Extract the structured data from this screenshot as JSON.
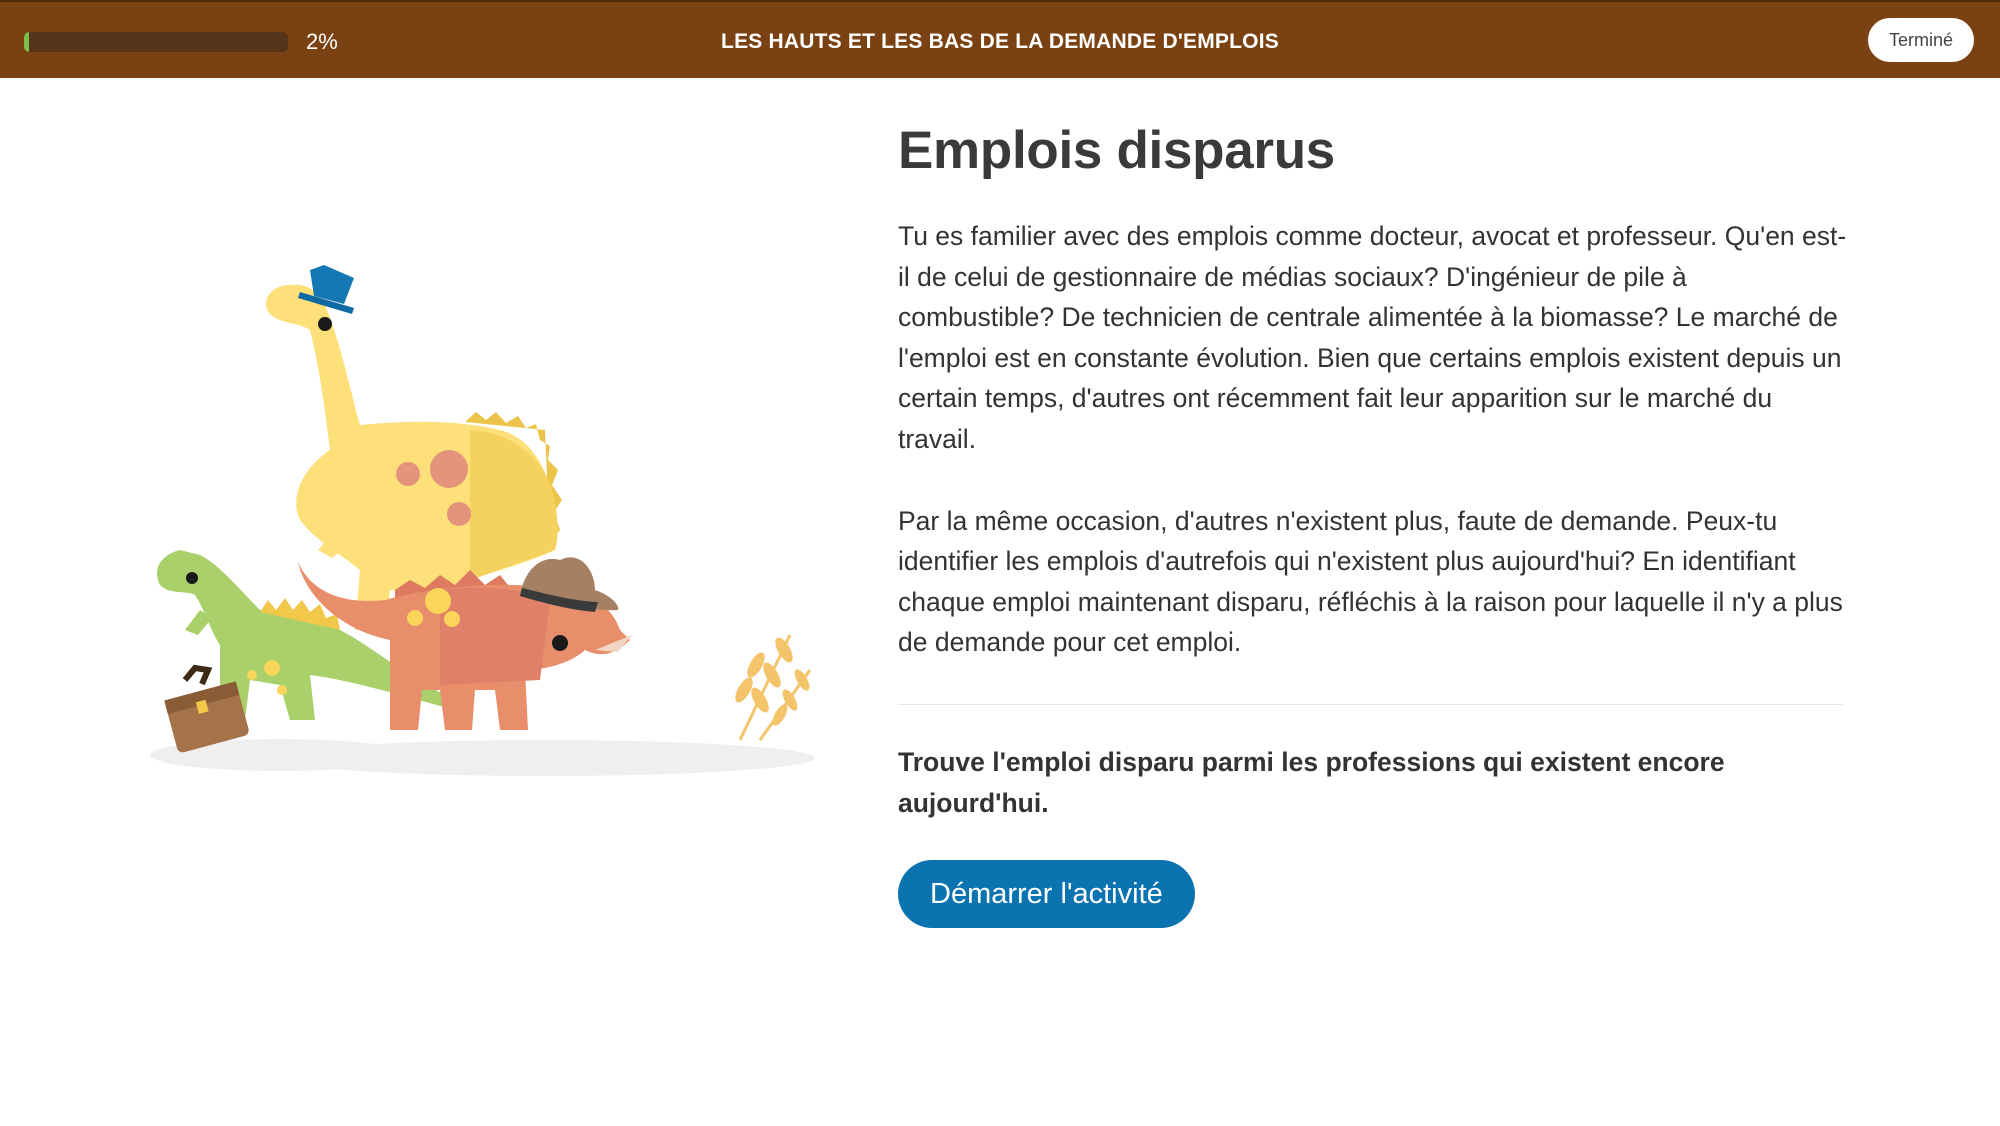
{
  "header": {
    "progress_value": 0.02,
    "progress_label": "2%",
    "title": "LES HAUTS ET LES BAS DE LA DEMANDE D'EMPLOIS",
    "done_label": "Terminé"
  },
  "main": {
    "heading": "Emplois disparus",
    "paragraphs": [
      "Tu es familier avec des emplois comme docteur, avocat et professeur. Qu'en est-il de celui de gestionnaire de médias sociaux? D'ingénieur de pile à combustible? De technicien de centrale alimentée à la biomasse? Le marché de l'emploi est en constante évolution. Bien que certains emplois existent depuis un certain temps, d'autres ont récemment fait leur apparition sur le marché du travail.",
      "Par la même occasion, d'autres n'existent plus, faute de demande. Peux-tu identifier les emplois d'autrefois qui n'existent plus aujourd'hui? En identifiant chaque emploi maintenant disparu, réfléchis à la raison pour laquelle il n'y a plus de demande pour cet emploi."
    ],
    "instruction": "Trouve l'emploi disparu parmi les professions qui existent encore aujourd'hui.",
    "start_label": "Démarrer l'activité"
  },
  "colors": {
    "header_bg": "#7a4212",
    "progress_fill": "#7cc04b",
    "primary_button": "#0b73b0"
  },
  "illustration": {
    "icons": [
      "dinosaurs-illustration",
      "top-hat-icon",
      "fedora-hat-icon",
      "briefcase-icon",
      "wheat-icon"
    ]
  }
}
